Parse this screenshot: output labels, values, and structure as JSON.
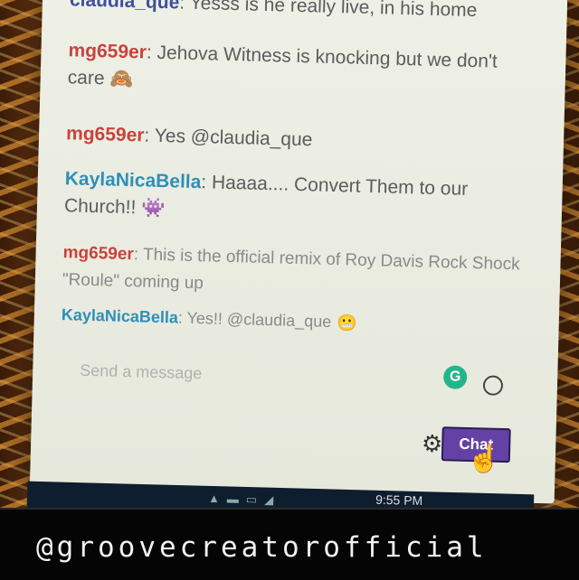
{
  "chat": {
    "messages": [
      {
        "user": "claudia_que",
        "sep": ": ",
        "text": "Yesss is he really live, in his home",
        "emoji": ""
      },
      {
        "user": "mg659er",
        "sep": ": ",
        "text": "Jehova Witness is knocking but we don't care",
        "emoji": "🙈"
      },
      {
        "user": "mg659er",
        "sep": ": ",
        "text": "Yes @claudia_que",
        "emoji": ""
      },
      {
        "user": "KaylaNicaBella",
        "sep": ": ",
        "text": "Haaaa.... Convert Them to our Church!!",
        "emoji": "👾"
      },
      {
        "user": "mg659er",
        "sep": ": ",
        "text": "This is the official remix of Roy Davis Rock Shock \"Roule\" coming up",
        "emoji": ""
      },
      {
        "user": "KaylaNicaBella",
        "sep": ": ",
        "text": "Yes!! @claudia_que",
        "emoji": "😬"
      }
    ],
    "composer": {
      "placeholder": "Send a message",
      "grammarly_label": "G",
      "chat_button_label": "Chat"
    }
  },
  "taskbar": {
    "time": "9:55 PM"
  },
  "banner": {
    "text": "@groovecreatorofficial"
  },
  "colors": {
    "claudia_que": "#3d4fa0",
    "mg659er": "#c8433d",
    "KaylaNicaBella": "#2f8fb8",
    "chat_button": "#6441a4"
  }
}
